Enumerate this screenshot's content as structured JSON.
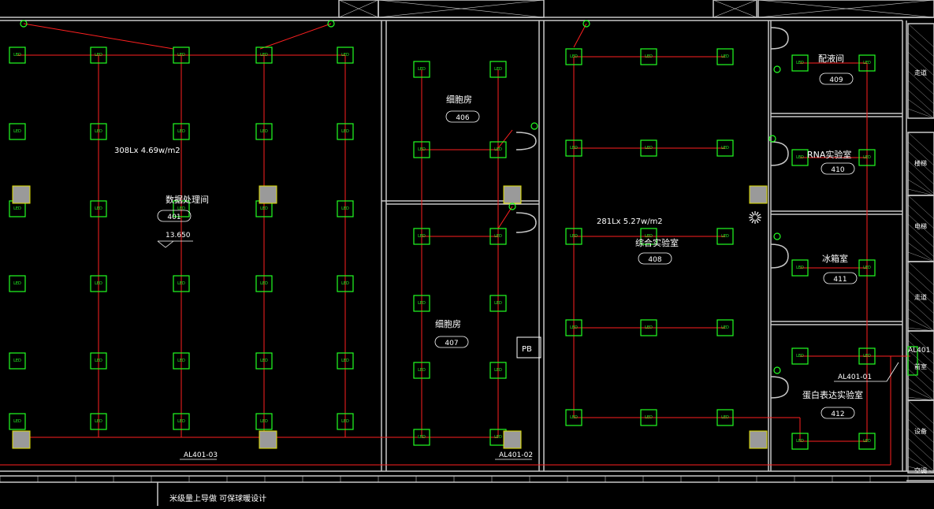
{
  "colors": {
    "background": "#000000",
    "wall": "#c8c8c8",
    "wire": "#ff2020",
    "fixture": "#22ff22",
    "annotation": "#ffffff",
    "equipment": "#9a9a9a"
  },
  "labels": {
    "lux_left": "308Lx 4.69w/m2",
    "lux_center": "281Lx 5.27w/m2",
    "elevation": "13.650",
    "bottom_strip": "米级量上导做 可保球暖设计",
    "pb": "PB",
    "circuit_1": "AL401-03",
    "circuit_2": "AL401-02",
    "circuit_3": "AL401-01",
    "panel_tag": "AL401",
    "fixture_text": "LED"
  },
  "rooms": [
    {
      "name": "数据处理间",
      "number": "401"
    },
    {
      "name": "细胞房",
      "number": "406"
    },
    {
      "name": "细胞房",
      "number": "407"
    },
    {
      "name": "综合实验室",
      "number": "408"
    },
    {
      "name": "配液间",
      "number": "409"
    },
    {
      "name": "RNA实验室",
      "number": "410"
    },
    {
      "name": "冰箱室",
      "number": "411"
    },
    {
      "name": "蛋白表达实验室",
      "number": "412"
    }
  ],
  "right_strip": [
    "走道",
    "楼梯",
    "电梯",
    "走道",
    "前室",
    "设备",
    "空调"
  ]
}
